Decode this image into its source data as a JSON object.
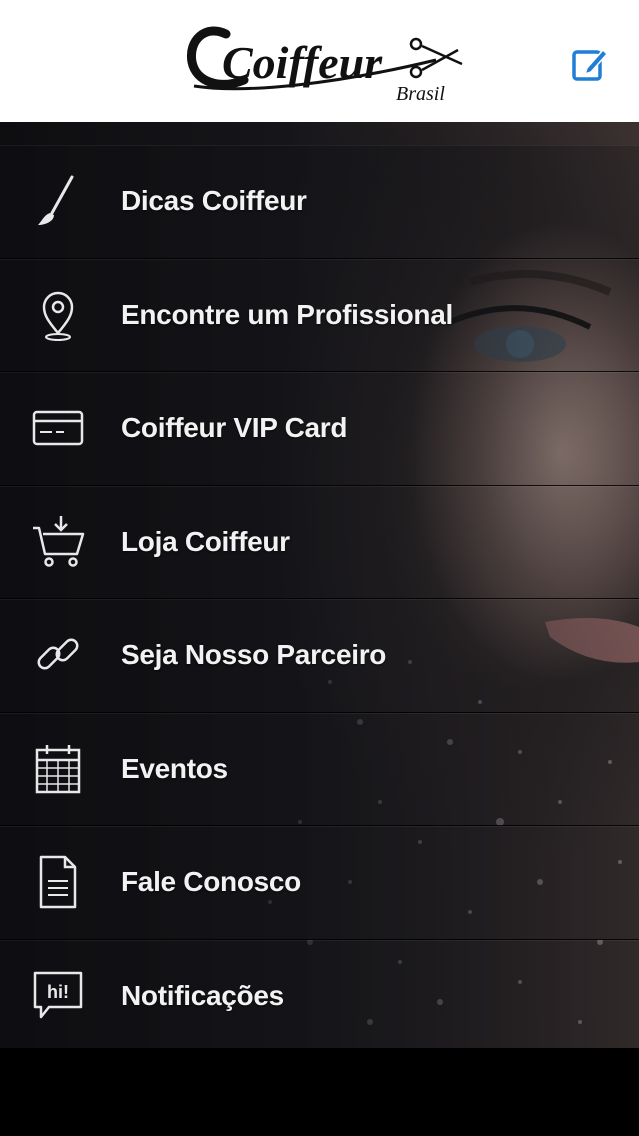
{
  "header": {
    "logo_main": "Coiffeur",
    "logo_sub": "Brasil",
    "edit_icon": "edit-icon",
    "accent_color": "#1f7ed6"
  },
  "menu": {
    "items": [
      {
        "label": "Dicas Coiffeur",
        "icon": "paintbrush-icon"
      },
      {
        "label": "Encontre um Profissional",
        "icon": "map-pin-icon"
      },
      {
        "label": "Coiffeur VIP Card",
        "icon": "credit-card-icon"
      },
      {
        "label": "Loja Coiffeur",
        "icon": "shopping-cart-icon"
      },
      {
        "label": "Seja Nosso Parceiro",
        "icon": "link-icon"
      },
      {
        "label": "Eventos",
        "icon": "calendar-icon"
      },
      {
        "label": "Fale Conosco",
        "icon": "document-icon"
      },
      {
        "label": "Notificações",
        "icon": "chat-bubble-icon"
      }
    ],
    "notification_icon_text": "hi!"
  }
}
